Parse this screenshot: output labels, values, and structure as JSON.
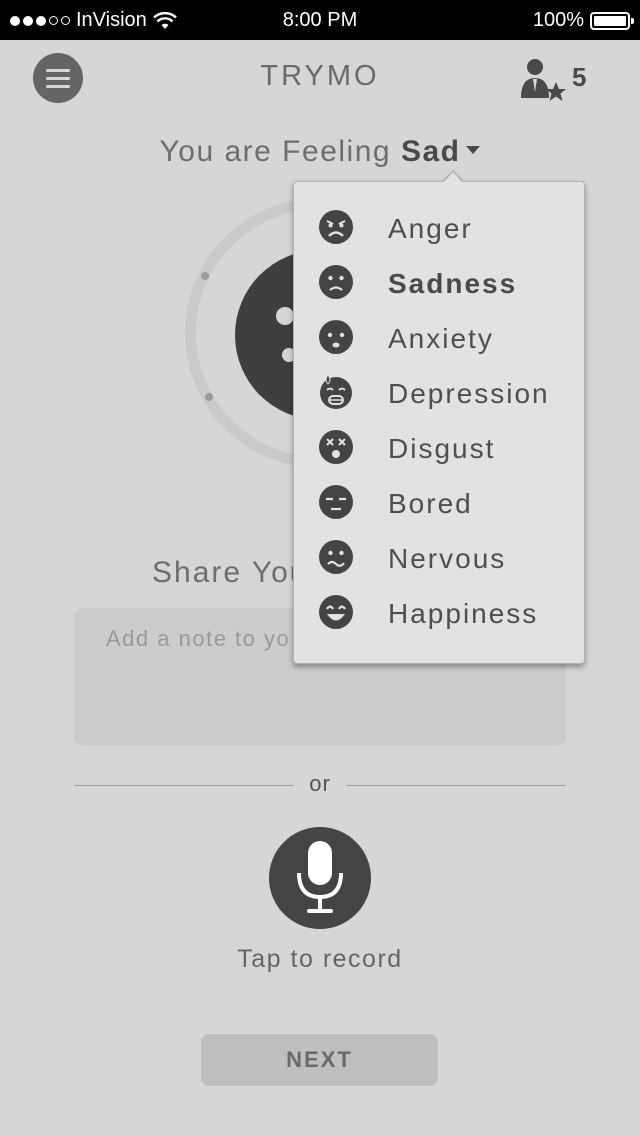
{
  "status_bar": {
    "carrier": "InVision",
    "time": "8:00 PM",
    "battery": "100%",
    "battery_level": 1.0,
    "signal_bars_filled": 3,
    "signal_bars_total": 5
  },
  "header": {
    "title": "TRYMO",
    "friend_count": "5",
    "menu_icon": "hamburger-icon",
    "profile_icon": "user-star-icon"
  },
  "feeling": {
    "prefix": "You are Feeling",
    "selected": "Sad"
  },
  "mood_menu": {
    "selected": "Sadness",
    "items": [
      {
        "label": "Anger",
        "icon": "angry-face-icon"
      },
      {
        "label": "Sadness",
        "icon": "sad-face-icon"
      },
      {
        "label": "Anxiety",
        "icon": "anxious-face-icon"
      },
      {
        "label": "Depression",
        "icon": "depressed-face-icon"
      },
      {
        "label": "Disgust",
        "icon": "disgusted-face-icon"
      },
      {
        "label": "Bored",
        "icon": "bored-face-icon"
      },
      {
        "label": "Nervous",
        "icon": "nervous-face-icon"
      },
      {
        "label": "Happiness",
        "icon": "happy-face-icon"
      }
    ]
  },
  "share": {
    "heading": "Share You",
    "note_placeholder": "Add a note to yo"
  },
  "divider": {
    "text": "or"
  },
  "record": {
    "label": "Tap to record",
    "icon": "microphone-icon"
  },
  "next_button": {
    "label": "NEXT"
  },
  "colors": {
    "background": "#d6d6d6",
    "dark": "#444444",
    "menu_bg": "#e2e2e2"
  }
}
